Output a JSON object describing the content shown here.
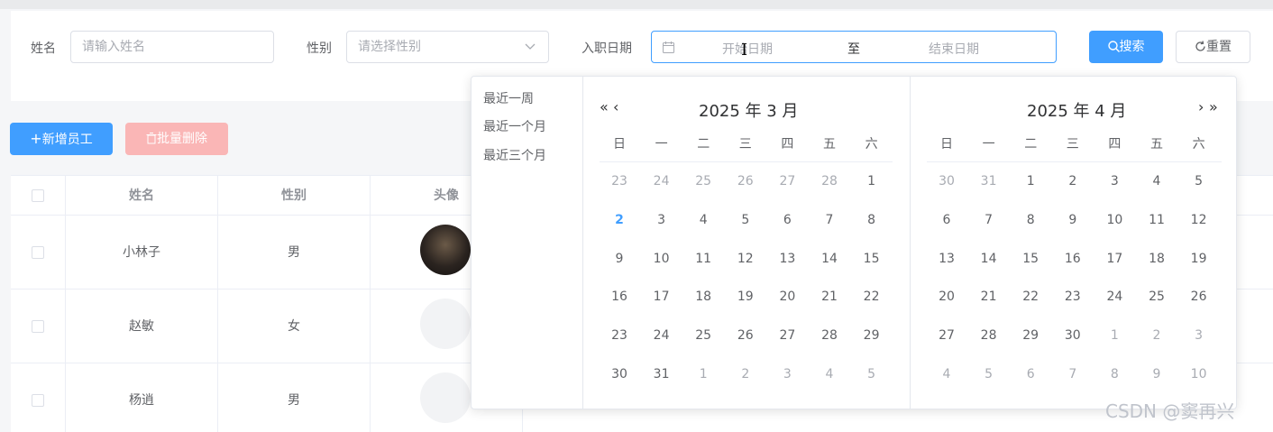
{
  "search": {
    "name_label": "姓名",
    "name_placeholder": "请输入姓名",
    "gender_label": "性别",
    "gender_placeholder": "请选择性别",
    "date_label": "入职日期",
    "date_start_placeholder": "开始日期",
    "date_separator": "至",
    "date_end_placeholder": "结束日期",
    "search_button": "搜索",
    "reset_button": "重置"
  },
  "actions": {
    "add_button": "新增员工",
    "batch_delete_button": "批量删除"
  },
  "table": {
    "columns": [
      "姓名",
      "性别",
      "头像"
    ],
    "rows": [
      {
        "name": "小林子",
        "gender": "男"
      },
      {
        "name": "赵敏",
        "gender": "女"
      },
      {
        "name": "杨逍",
        "gender": "男"
      }
    ]
  },
  "datepicker": {
    "shortcuts": [
      "最近一周",
      "最近一个月",
      "最近三个月"
    ],
    "left": {
      "title": "2025 年 3 月",
      "weekdays": [
        "日",
        "一",
        "二",
        "三",
        "四",
        "五",
        "六"
      ],
      "days": [
        [
          "23",
          "24",
          "25",
          "26",
          "27",
          "28",
          "1"
        ],
        [
          "2",
          "3",
          "4",
          "5",
          "6",
          "7",
          "8"
        ],
        [
          "9",
          "10",
          "11",
          "12",
          "13",
          "14",
          "15"
        ],
        [
          "16",
          "17",
          "18",
          "19",
          "20",
          "21",
          "22"
        ],
        [
          "23",
          "24",
          "25",
          "26",
          "27",
          "28",
          "29"
        ],
        [
          "30",
          "31",
          "1",
          "2",
          "3",
          "4",
          "5"
        ]
      ]
    },
    "right": {
      "title": "2025 年 4 月",
      "weekdays": [
        "日",
        "一",
        "二",
        "三",
        "四",
        "五",
        "六"
      ],
      "days": [
        [
          "30",
          "31",
          "1",
          "2",
          "3",
          "4",
          "5"
        ],
        [
          "6",
          "7",
          "8",
          "9",
          "10",
          "11",
          "12"
        ],
        [
          "13",
          "14",
          "15",
          "16",
          "17",
          "18",
          "19"
        ],
        [
          "20",
          "21",
          "22",
          "23",
          "24",
          "25",
          "26"
        ],
        [
          "27",
          "28",
          "29",
          "30",
          "1",
          "2",
          "3"
        ],
        [
          "4",
          "5",
          "6",
          "7",
          "8",
          "9",
          "10"
        ]
      ]
    }
  },
  "watermark": "CSDN @窦再兴",
  "colors": {
    "primary": "#409eff",
    "danger_disabled": "#fab6b6",
    "border": "#dcdfe6"
  },
  "icons": {
    "calendar": "calendar-icon",
    "search": "search-icon",
    "refresh": "refresh-icon",
    "plus": "plus-icon",
    "trash": "trash-icon",
    "chevron_down": "chevron-down-icon"
  }
}
